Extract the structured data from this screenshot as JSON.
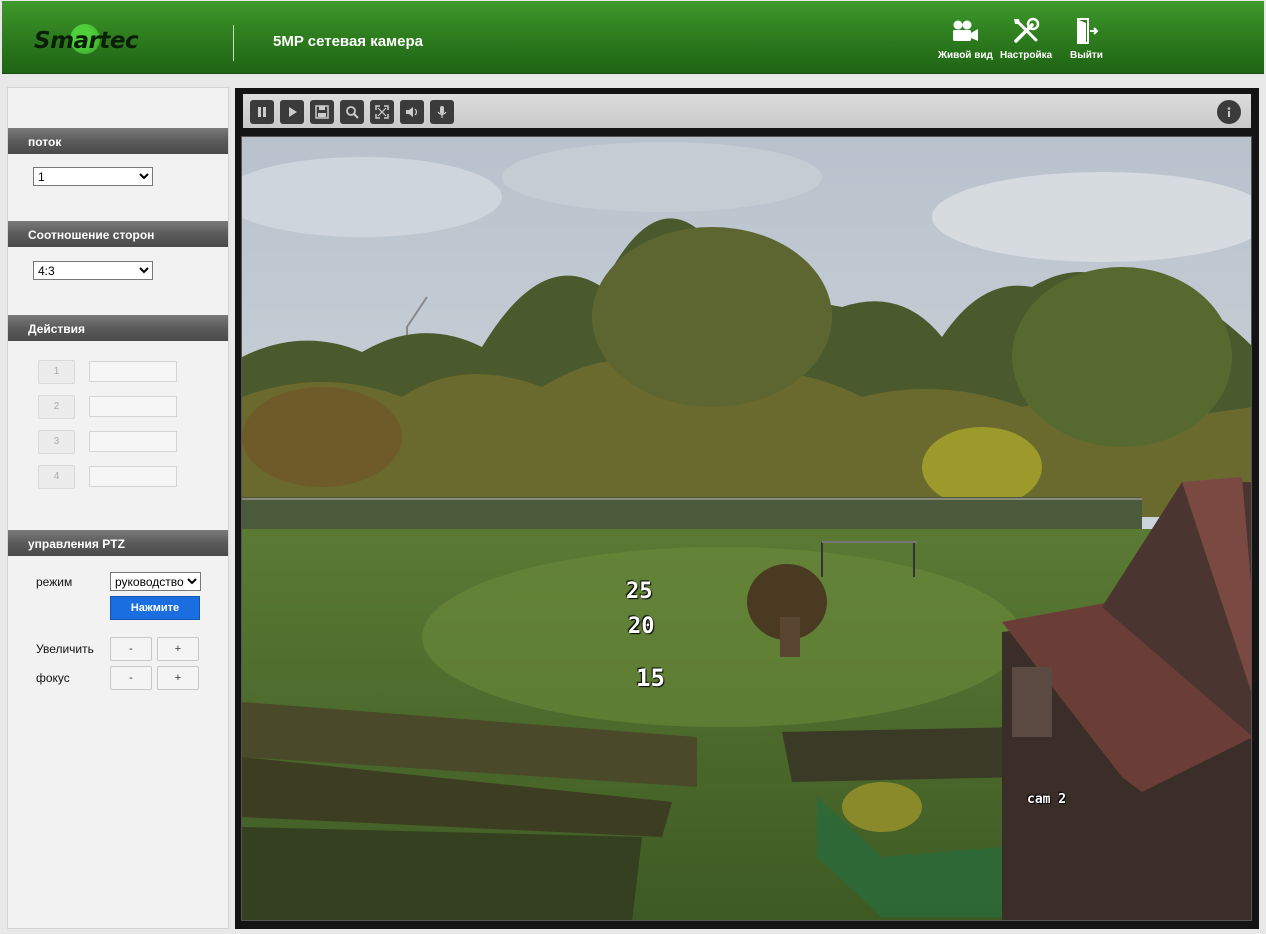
{
  "header": {
    "logo_text": "Smartec",
    "title": "5MP сетевая камера",
    "nav": [
      {
        "label": "Живой вид",
        "icon": "video-camera-icon"
      },
      {
        "label": "Настройка",
        "icon": "tools-icon"
      },
      {
        "label": "Выйти",
        "icon": "exit-door-icon"
      }
    ]
  },
  "sidebar": {
    "stream": {
      "heading": "поток",
      "value": "1"
    },
    "aspect": {
      "heading": "Соотношение сторон",
      "value": "4:3"
    },
    "actions": {
      "heading": "Действия",
      "presets": [
        "1",
        "2",
        "3",
        "4"
      ]
    },
    "ptz": {
      "heading": "управления PTZ",
      "mode_label": "режим",
      "mode_value": "руководство",
      "go_label": "Нажмите",
      "zoom_label": "Увеличить",
      "focus_label": "фокус",
      "minus": "-",
      "plus": "+"
    }
  },
  "toolbar": {
    "icons": [
      "pause-icon",
      "play-icon",
      "record-icon",
      "zoom-icon",
      "fullscreen-icon",
      "audio-icon",
      "microphone-icon",
      "info-icon"
    ]
  },
  "video": {
    "overlay_text": "cam 2",
    "numbers": [
      "25",
      "20",
      "15"
    ]
  },
  "colors": {
    "header_green": "#2f7f1f",
    "accent_blue": "#1a6ee0",
    "section_gray": "#5b5b5b"
  }
}
